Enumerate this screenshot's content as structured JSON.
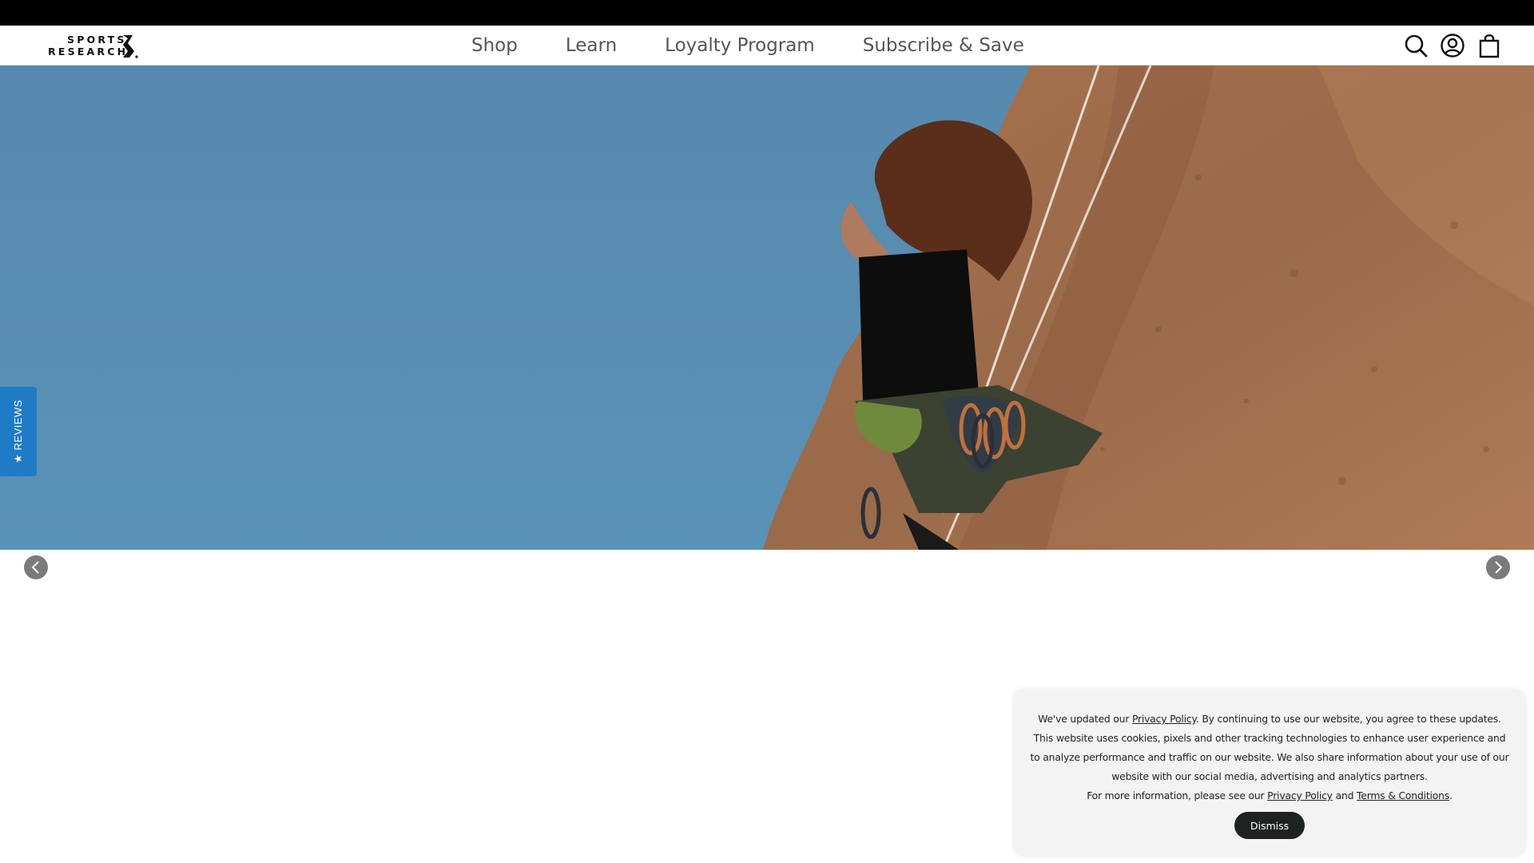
{
  "header": {
    "logo_line1": "SPORTS",
    "logo_line2": "RESEARCH",
    "nav": [
      "Shop",
      "Learn",
      "Loyalty Program",
      "Subscribe & Save"
    ],
    "icons": [
      "search-icon",
      "account-icon",
      "cart-icon"
    ]
  },
  "hero": {
    "sky_color": "#5b8fb4",
    "rock_color": "#9b6a48",
    "prev_icon": "chevron-left-icon",
    "next_icon": "chevron-right-icon"
  },
  "reviews_tab": {
    "label": "★ REVIEWS",
    "color": "#1f7bc6"
  },
  "cookie": {
    "line1_pre": "We've updated our ",
    "privacy_link": "Privacy Policy",
    "line1_post": ". By continuing to use our website, you agree to these updates. This website uses cookies, pixels and other tracking technologies to enhance user experience and to analyze performance and traffic on our website. We also share information about your use of our website with our social media, advertising and analytics partners.",
    "line2_pre": "For more information, please see our ",
    "privacy_link2": "Privacy Policy",
    "and": " and ",
    "terms_link": "Terms & Conditions",
    "period": ".",
    "dismiss": "Dismiss"
  }
}
